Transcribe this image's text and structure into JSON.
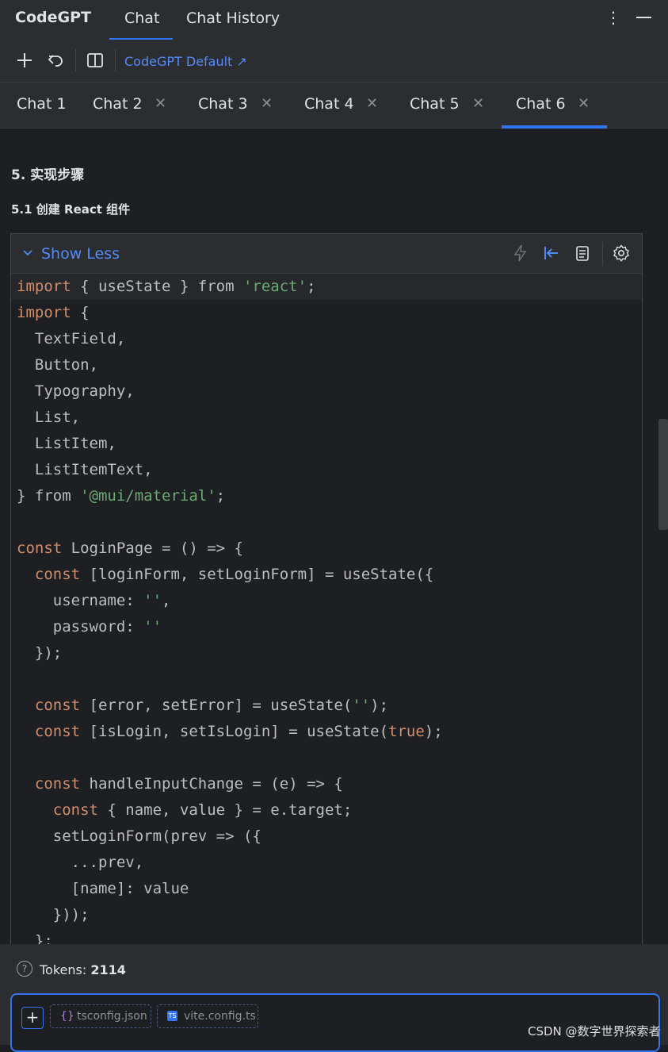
{
  "header": {
    "brand": "CodeGPT",
    "tabs": [
      "Chat",
      "Chat History"
    ]
  },
  "toolbar": {
    "model_label": "CodeGPT Default ↗"
  },
  "chat_tabs": [
    "Chat 1",
    "Chat 2",
    "Chat 3",
    "Chat 4",
    "Chat 5",
    "Chat 6"
  ],
  "content": {
    "heading": "5. 实现步骤",
    "subheading": "5.1 创建 React 组件",
    "code_toggle": "Show Less"
  },
  "footer": {
    "tokens_label": "Tokens: ",
    "tokens_value": "2114",
    "files": [
      "tsconfig.json",
      "vite.config.ts"
    ]
  },
  "watermark": "CSDN @数字世界探索者",
  "colors": {
    "accent": "#3574f0",
    "link": "#548af7",
    "keyword": "#cf8e6d",
    "string": "#6aab73"
  }
}
